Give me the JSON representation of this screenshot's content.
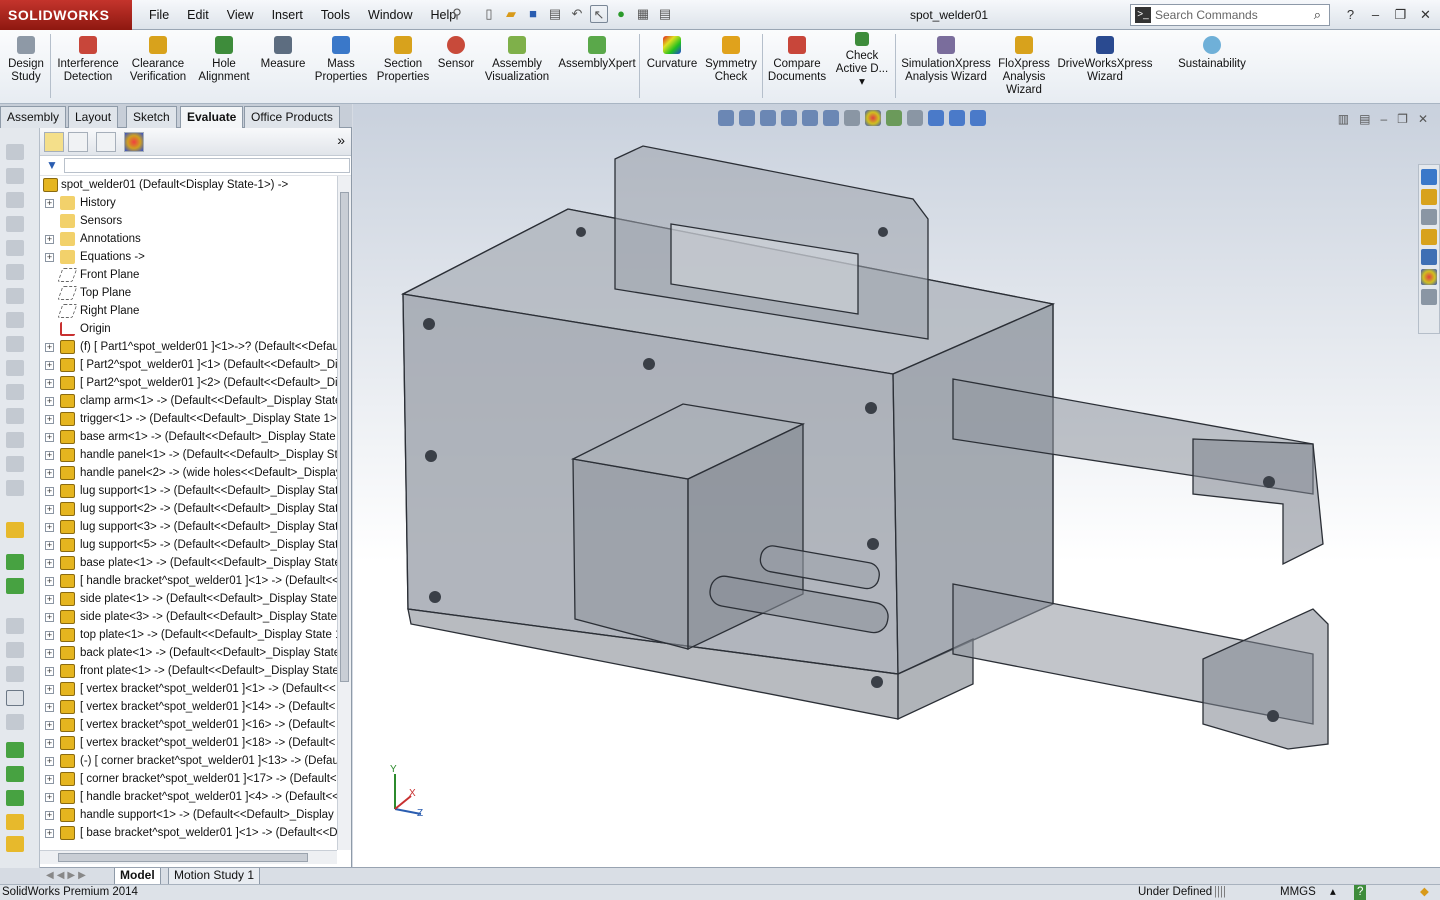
{
  "app": {
    "logo_text": "SOLIDWORKS",
    "document_title": "spot_welder01",
    "status_product": "SolidWorks Premium 2014"
  },
  "menu": [
    "File",
    "Edit",
    "View",
    "Insert",
    "Tools",
    "Window",
    "Help"
  ],
  "search": {
    "placeholder": "Search Commands"
  },
  "command_manager": [
    {
      "label1": "Design",
      "label2": "Study",
      "icon": "design-study-icon"
    },
    {
      "label1": "Interference",
      "label2": "Detection",
      "icon": "interference-icon"
    },
    {
      "label1": "Clearance",
      "label2": "Verification",
      "icon": "clearance-icon"
    },
    {
      "label1": "Hole",
      "label2": "Alignment",
      "icon": "hole-alignment-icon"
    },
    {
      "label1": "Measure",
      "label2": "",
      "icon": "measure-icon"
    },
    {
      "label1": "Mass",
      "label2": "Properties",
      "icon": "mass-icon"
    },
    {
      "label1": "Section",
      "label2": "Properties",
      "icon": "section-icon"
    },
    {
      "label1": "Sensor",
      "label2": "",
      "icon": "sensor-icon"
    },
    {
      "label1": "Assembly",
      "label2": "Visualization",
      "icon": "assembly-vis-icon"
    },
    {
      "label1": "AssemblyXpert",
      "label2": "",
      "icon": "assemblyxpert-icon"
    },
    {
      "label1": "Curvature",
      "label2": "",
      "icon": "curvature-icon"
    },
    {
      "label1": "Symmetry",
      "label2": "Check",
      "icon": "symmetry-icon"
    },
    {
      "label1": "Compare",
      "label2": "Documents",
      "icon": "compare-icon"
    },
    {
      "label1": "Check",
      "label2": "Active D...",
      "icon": "check-icon"
    },
    {
      "label1": "SimulationXpress",
      "label2": "Analysis Wizard",
      "icon": "simxpress-icon"
    },
    {
      "label1": "FloXpress",
      "label2": "Analysis",
      "label3": "Wizard",
      "icon": "floxpress-icon"
    },
    {
      "label1": "DriveWorksXpress",
      "label2": "Wizard",
      "icon": "driveworks-icon"
    },
    {
      "label1": "Sustainability",
      "label2": "",
      "icon": "sustainability-icon"
    }
  ],
  "tabs": [
    "Assembly",
    "Layout",
    "Sketch",
    "Evaluate",
    "Office Products"
  ],
  "active_tab": "Evaluate",
  "tree": [
    {
      "label": "spot_welder01  (Default<Display State-1>) ->",
      "type": "root"
    },
    {
      "label": "History",
      "type": "folder",
      "expand": true
    },
    {
      "label": "Sensors",
      "type": "folder",
      "expand": false
    },
    {
      "label": "Annotations",
      "type": "folder",
      "expand": true
    },
    {
      "label": "Equations ->",
      "type": "folder",
      "expand": true
    },
    {
      "label": "Front Plane",
      "type": "plane",
      "expand": false
    },
    {
      "label": "Top Plane",
      "type": "plane",
      "expand": false
    },
    {
      "label": "Right Plane",
      "type": "plane",
      "expand": false
    },
    {
      "label": "Origin",
      "type": "origin",
      "expand": false
    },
    {
      "label": "(f) [ Part1^spot_welder01 ]<1>->? (Default<<Defau",
      "type": "part",
      "expand": true
    },
    {
      "label": "[ Part2^spot_welder01 ]<1> (Default<<Default>_Di",
      "type": "part",
      "expand": true
    },
    {
      "label": "[ Part2^spot_welder01 ]<2> (Default<<Default>_Di",
      "type": "part",
      "expand": true
    },
    {
      "label": "clamp arm<1> -> (Default<<Default>_Display State",
      "type": "part",
      "expand": true
    },
    {
      "label": "trigger<1> -> (Default<<Default>_Display State 1>",
      "type": "part",
      "expand": true
    },
    {
      "label": "base arm<1> -> (Default<<Default>_Display State",
      "type": "part",
      "expand": true
    },
    {
      "label": "handle panel<1> -> (Default<<Default>_Display Sta",
      "type": "part",
      "expand": true
    },
    {
      "label": "handle panel<2> -> (wide holes<<Default>_Display",
      "type": "part",
      "expand": true
    },
    {
      "label": "lug support<1> -> (Default<<Default>_Display Stat",
      "type": "part",
      "expand": true
    },
    {
      "label": "lug support<2> -> (Default<<Default>_Display Stat",
      "type": "part",
      "expand": true
    },
    {
      "label": "lug support<3> -> (Default<<Default>_Display Stat",
      "type": "part",
      "expand": true
    },
    {
      "label": "lug support<5> -> (Default<<Default>_Display Stat",
      "type": "part",
      "expand": true
    },
    {
      "label": "base plate<1> -> (Default<<Default>_Display State",
      "type": "part",
      "expand": true
    },
    {
      "label": "[ handle bracket^spot_welder01 ]<1> -> (Default<<",
      "type": "part",
      "expand": true
    },
    {
      "label": "side plate<1> -> (Default<<Default>_Display State",
      "type": "part",
      "expand": true
    },
    {
      "label": "side plate<3> -> (Default<<Default>_Display State",
      "type": "part",
      "expand": true
    },
    {
      "label": "top plate<1> -> (Default<<Default>_Display State 1",
      "type": "part",
      "expand": true
    },
    {
      "label": "back plate<1> -> (Default<<Default>_Display State",
      "type": "part",
      "expand": true
    },
    {
      "label": "front plate<1> -> (Default<<Default>_Display State",
      "type": "part",
      "expand": true
    },
    {
      "label": "[ vertex bracket^spot_welder01 ]<1> -> (Default<<",
      "type": "part",
      "expand": true
    },
    {
      "label": "[ vertex bracket^spot_welder01 ]<14> -> (Default<",
      "type": "part",
      "expand": true
    },
    {
      "label": "[ vertex bracket^spot_welder01 ]<16> -> (Default<",
      "type": "part",
      "expand": true
    },
    {
      "label": "[ vertex bracket^spot_welder01 ]<18> -> (Default<",
      "type": "part",
      "expand": true
    },
    {
      "label": "(-) [ corner bracket^spot_welder01 ]<13> -> (Defau",
      "type": "part",
      "expand": true
    },
    {
      "label": "[ corner bracket^spot_welder01 ]<17> -> (Default<",
      "type": "part",
      "expand": true
    },
    {
      "label": "[ handle bracket^spot_welder01 ]<4> -> (Default<<",
      "type": "part",
      "expand": true
    },
    {
      "label": "handle support<1> -> (Default<<Default>_Display S",
      "type": "part",
      "expand": true
    },
    {
      "label": "[ base bracket^spot_welder01 ]<1> -> (Default<<D",
      "type": "part",
      "expand": true
    }
  ],
  "bottom_tabs": [
    "Model",
    "Motion Study 1"
  ],
  "status": {
    "state": "Under Defined",
    "units": "MMGS",
    "help": "?"
  },
  "triad": {
    "x": "X",
    "y": "Y",
    "z": "Z"
  },
  "colors": {
    "brand": "#b8261e",
    "accent": "#3a78c9",
    "part_icon": "#e5b51f"
  }
}
